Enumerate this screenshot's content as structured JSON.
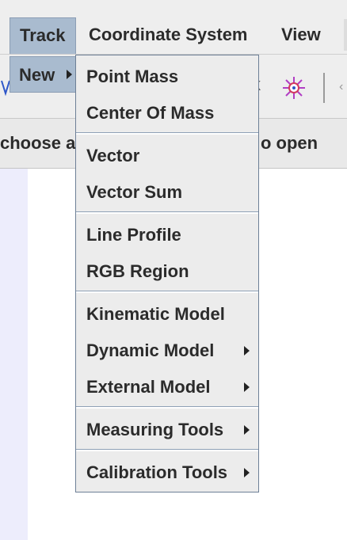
{
  "menubar": {
    "track": "Track",
    "coordinate_system": "Coordinate System",
    "view": "View"
  },
  "submenu": {
    "new": "New"
  },
  "instruction": {
    "left_text": "choose a",
    "right_text": "o open"
  },
  "toolbar": {
    "fragment_text": "k"
  },
  "popup": {
    "groups": [
      [
        "Point Mass",
        "Center Of Mass"
      ],
      [
        "Vector",
        "Vector Sum"
      ],
      [
        "Line Profile",
        "RGB Region"
      ],
      [
        "Kinematic Model",
        "Dynamic Model",
        "External Model"
      ],
      [
        "Measuring Tools"
      ],
      [
        "Calibration Tools"
      ]
    ],
    "items": {
      "point_mass": "Point Mass",
      "center_of_mass": "Center Of Mass",
      "vector": "Vector",
      "vector_sum": "Vector Sum",
      "line_profile": "Line Profile",
      "rgb_region": "RGB Region",
      "kinematic_model": "Kinematic Model",
      "dynamic_model": "Dynamic Model",
      "external_model": "External Model",
      "measuring_tools": "Measuring Tools",
      "calibration_tools": "Calibration Tools"
    }
  },
  "colors": {
    "selected_bg": "#a9bbcf",
    "menu_bg": "#ececec",
    "work_left": "#ededfc"
  }
}
